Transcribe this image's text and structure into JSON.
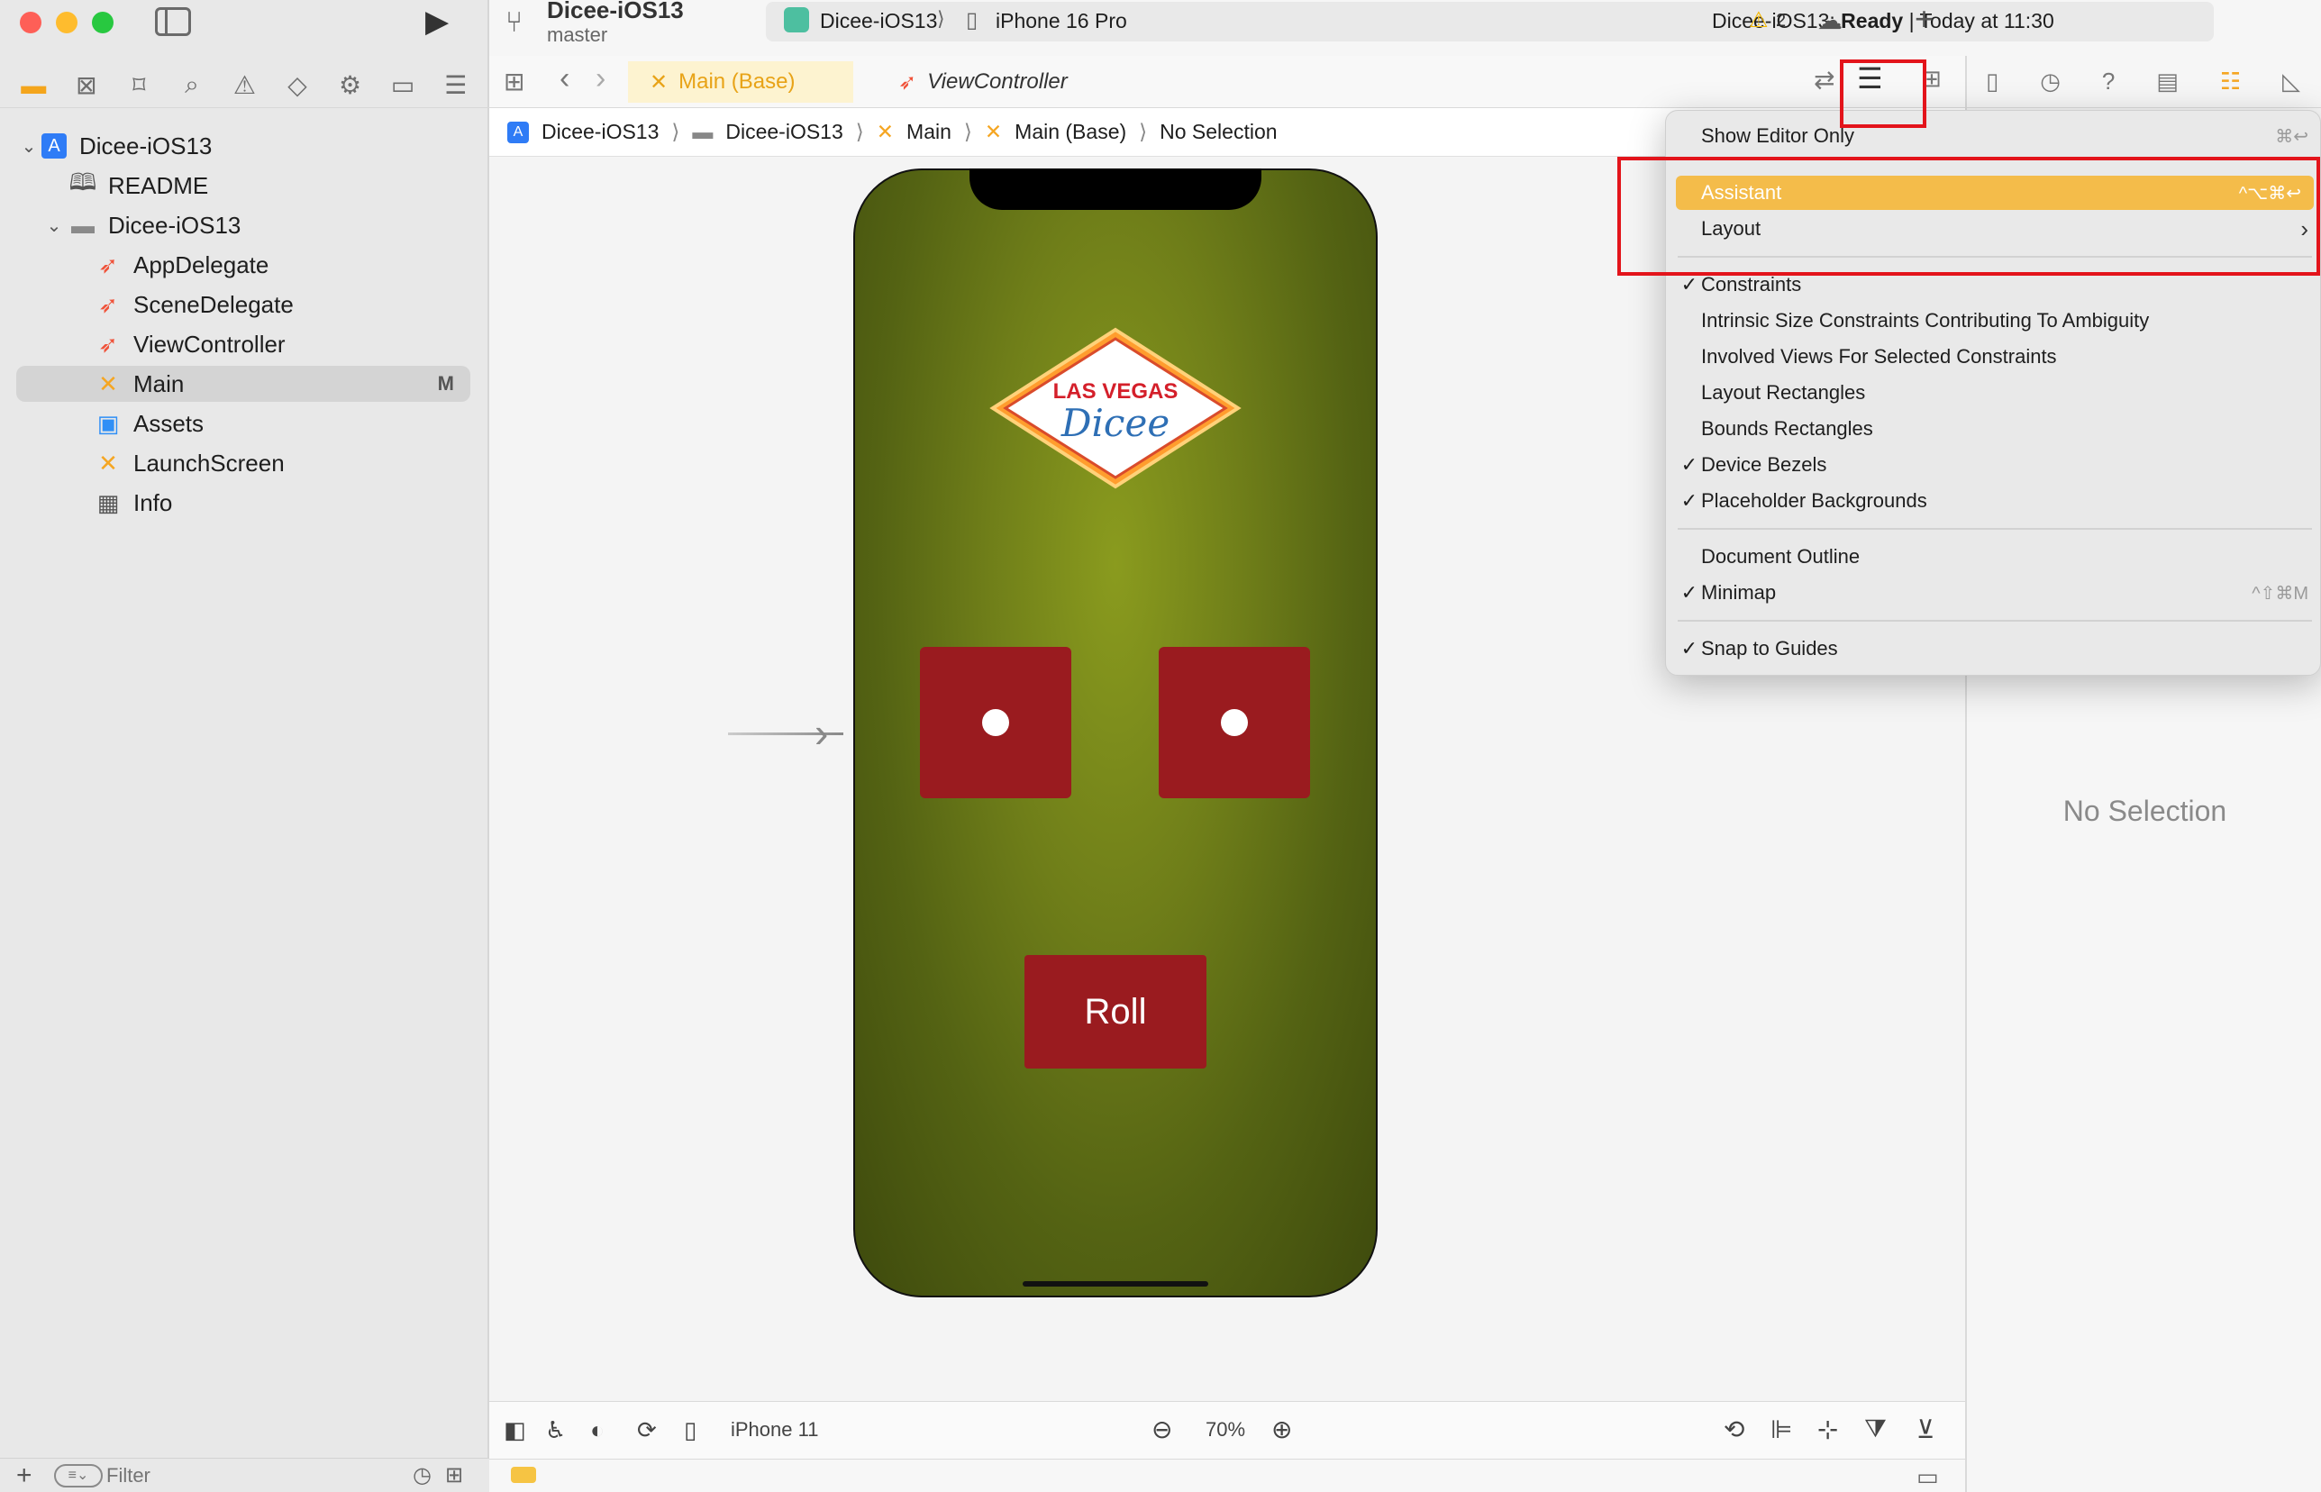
{
  "window": {
    "project_name": "Dicee-iOS13",
    "branch": "master",
    "scheme": "Dicee-iOS13",
    "device": "iPhone 16 Pro",
    "status_prefix": "Dicee-iOS13: ",
    "status_state": "Ready",
    "status_suffix": " | Today at 11:30",
    "warning_count": "2"
  },
  "navigator": {
    "items": [
      {
        "label": "Dicee-iOS13",
        "icon": "xcode-project-icon"
      },
      {
        "label": "README",
        "icon": "book-icon"
      },
      {
        "label": "Dicee-iOS13",
        "icon": "folder-icon"
      },
      {
        "label": "AppDelegate",
        "icon": "swift-icon"
      },
      {
        "label": "SceneDelegate",
        "icon": "swift-icon"
      },
      {
        "label": "ViewController",
        "icon": "swift-icon"
      },
      {
        "label": "Main",
        "icon": "storyboard-icon",
        "badge": "M"
      },
      {
        "label": "Assets",
        "icon": "assets-icon"
      },
      {
        "label": "LaunchScreen",
        "icon": "storyboard-icon"
      },
      {
        "label": "Info",
        "icon": "table-icon"
      }
    ],
    "filter_placeholder": "Filter"
  },
  "tabs": {
    "active": "Main (Base)",
    "second": "ViewController"
  },
  "breadcrumb": [
    "Dicee-iOS13",
    "Dicee-iOS13",
    "Main",
    "Main (Base)",
    "No Selection"
  ],
  "canvas": {
    "logo_top": "LAS VEGAS",
    "logo_bottom": "Dicee",
    "roll_label": "Roll"
  },
  "bottom": {
    "device": "iPhone 11",
    "zoom": "70%"
  },
  "inspector": {
    "empty_text": "No Selection"
  },
  "menu": {
    "items": [
      {
        "label": "Show Editor Only",
        "checked": false,
        "shortcut": "⌘↩"
      },
      {
        "label": "Assistant",
        "checked": false,
        "shortcut": "^⌥⌘↩",
        "highlighted": true
      },
      {
        "label": "Layout",
        "checked": false,
        "shortcut": "›"
      },
      {
        "label": "Constraints",
        "checked": true,
        "shortcut": ""
      },
      {
        "label": "Intrinsic Size Constraints Contributing To Ambiguity",
        "checked": false,
        "shortcut": ""
      },
      {
        "label": "Involved Views For Selected Constraints",
        "checked": false,
        "shortcut": ""
      },
      {
        "label": "Layout Rectangles",
        "checked": false,
        "shortcut": ""
      },
      {
        "label": "Bounds Rectangles",
        "checked": false,
        "shortcut": ""
      },
      {
        "label": "Device Bezels",
        "checked": true,
        "shortcut": ""
      },
      {
        "label": "Placeholder Backgrounds",
        "checked": true,
        "shortcut": ""
      },
      {
        "label": "Document Outline",
        "checked": false,
        "shortcut": ""
      },
      {
        "label": "Minimap",
        "checked": true,
        "shortcut": "^⇧⌘M"
      },
      {
        "label": "Snap to Guides",
        "checked": true,
        "shortcut": ""
      }
    ],
    "check_mark": "✓"
  },
  "colors": {
    "accent_highlight": "#f4bc4a",
    "annotation_red": "#e3141b",
    "die_red": "#9a1b1f",
    "felt_green": "#6f7e19"
  }
}
